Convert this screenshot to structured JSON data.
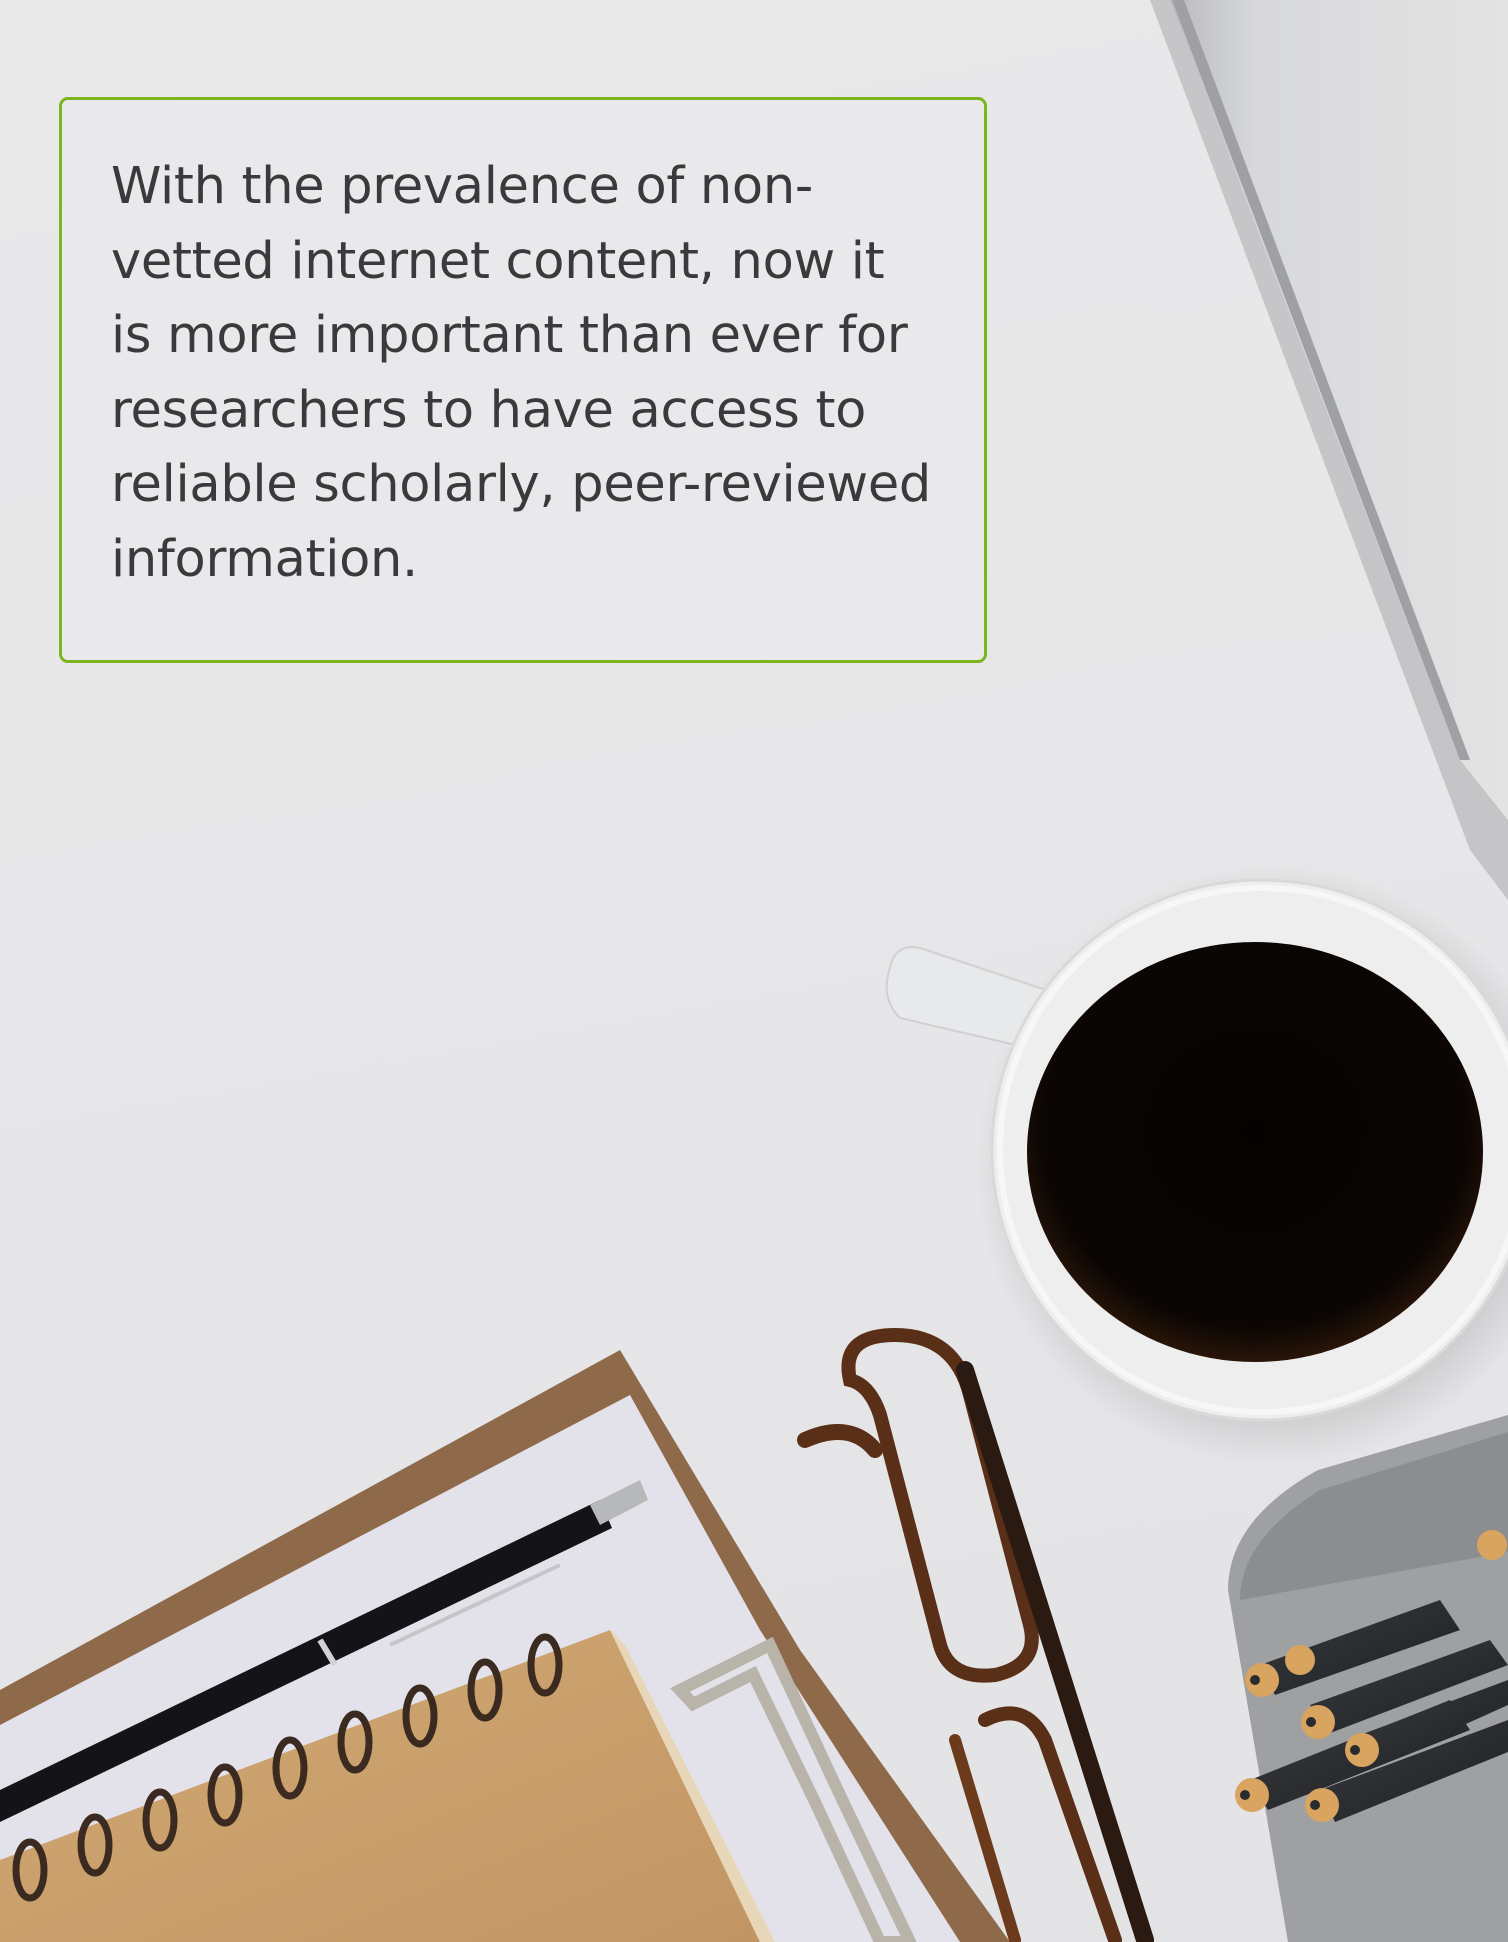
{
  "quote": {
    "lines": [
      "With the prevalence of non-",
      "vetted internet content, now it",
      "is more important than ever for",
      "researchers to have access to",
      "reliable scholarly, peer-reviewed",
      "information."
    ]
  },
  "colors": {
    "accent_border": "#7bb51f",
    "text": "#3a3a3c",
    "coffee": "#0b0604",
    "notebook": "#c9a06a",
    "clipboard": "#8e6a4b"
  }
}
